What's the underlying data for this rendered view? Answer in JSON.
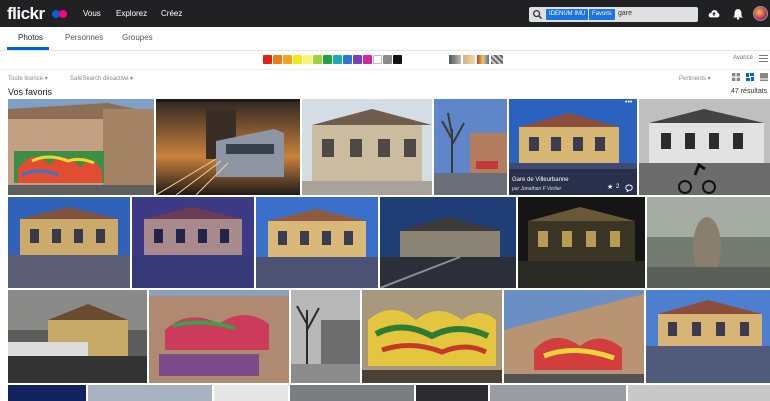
{
  "header": {
    "logo": "flickr",
    "nav": [
      "Vous",
      "Explorez",
      "Créez"
    ],
    "search": {
      "tags": [
        "IDENUM IMU",
        "Favoris"
      ],
      "query": "gare"
    }
  },
  "subnav": {
    "tabs": [
      "Photos",
      "Personnes",
      "Groupes"
    ],
    "active": "Photos"
  },
  "colors": {
    "swatches": [
      "#e22212",
      "#ef7b12",
      "#f5a418",
      "#f7e616",
      "#fcf36e",
      "#9ed13e",
      "#1fa43d",
      "#1ca9b0",
      "#2b78d1",
      "#7a3ec1",
      "#d2269a",
      "#ffffff",
      "#8a8a8a",
      "#111111"
    ],
    "advanced_label": "Avancé"
  },
  "filters": {
    "license": "Toute licence ▾",
    "safesearch": "SafeSearch désactivé ▾",
    "sort": "Pertinents ▾"
  },
  "gallery": {
    "title": "Vos favoris",
    "count": "47 résultats",
    "hover_caption": "Gare de Villeurbanne",
    "hover_author": "par Jonathan F Verlier",
    "hover_faves": "2"
  }
}
